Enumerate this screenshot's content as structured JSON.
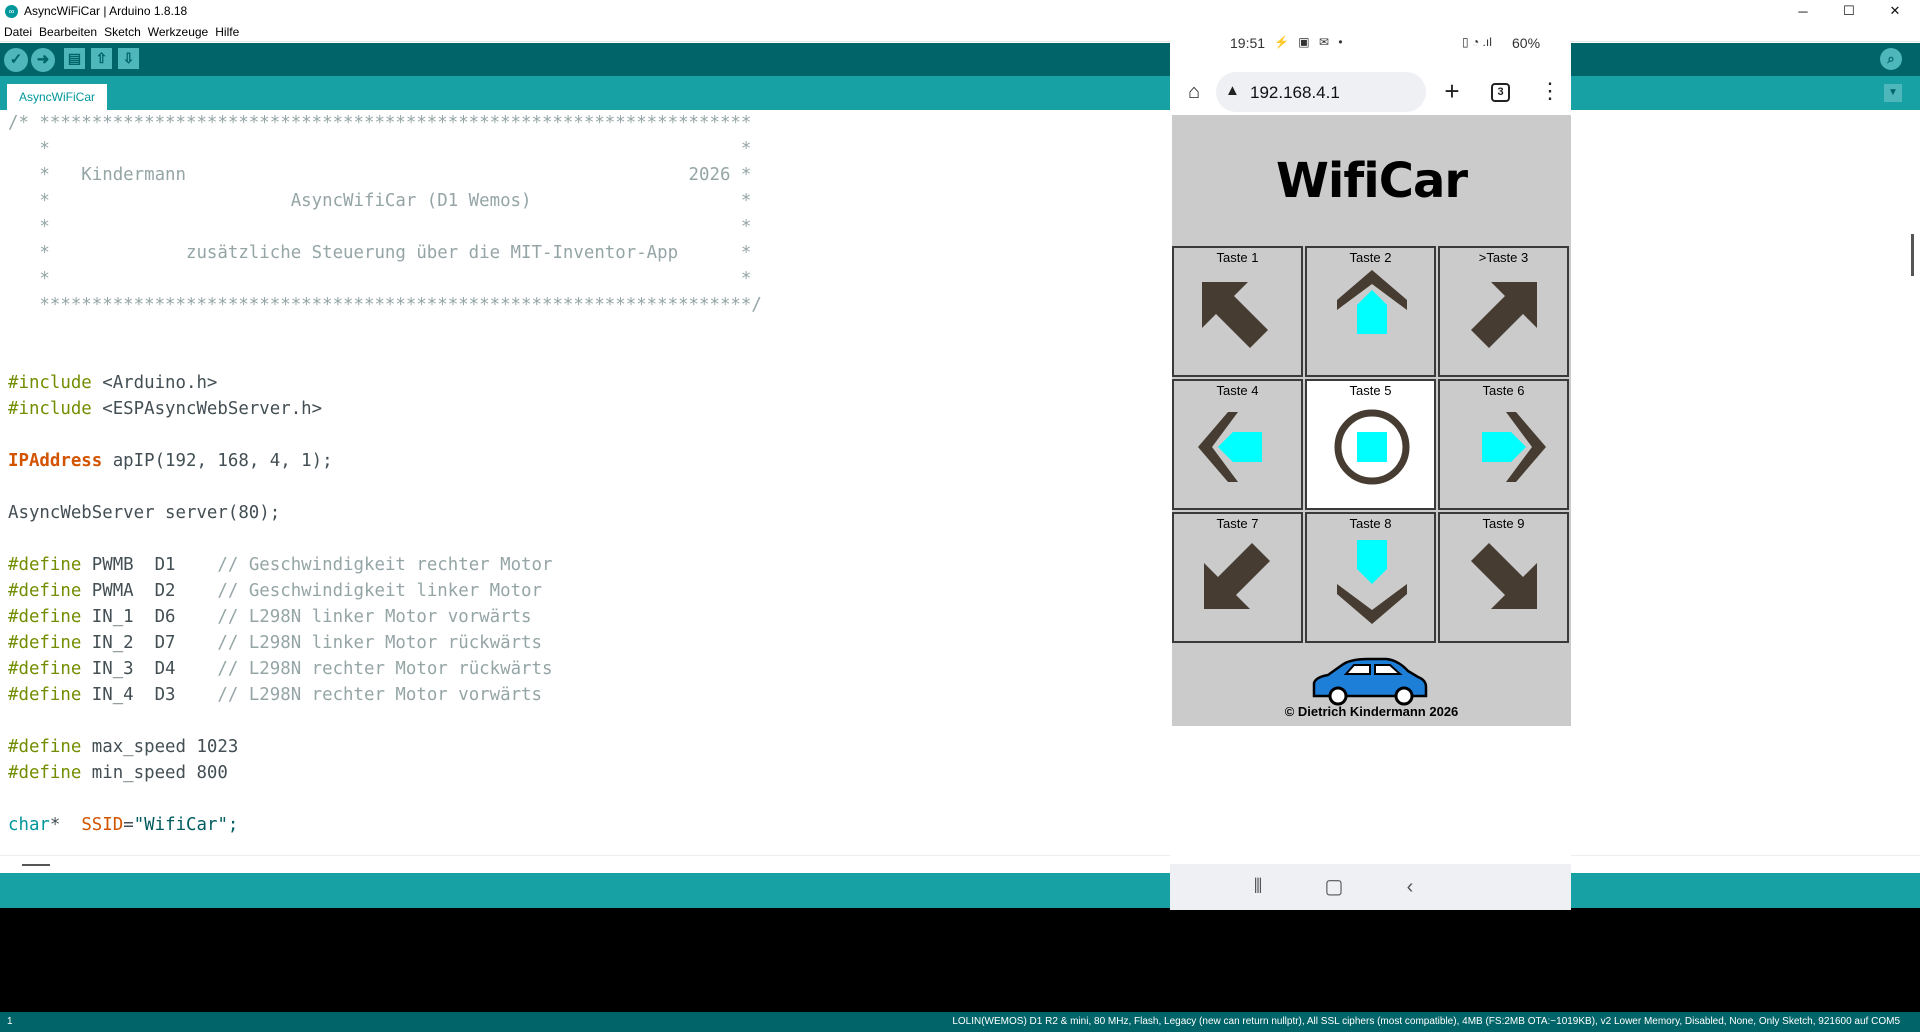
{
  "window": {
    "title": "AsyncWiFiCar | Arduino 1.8.18",
    "minimize": "─",
    "maximize": "☐",
    "close": "✕"
  },
  "menu": {
    "items": [
      "Datei",
      "Bearbeiten",
      "Sketch",
      "Werkzeuge",
      "Hilfe"
    ]
  },
  "toolbar": {
    "verify_icon": "check-icon",
    "upload_icon": "arrow-right-icon",
    "new_icon": "new-file-icon",
    "open_icon": "open-icon",
    "save_icon": "save-icon",
    "serial_monitor_icon": "magnifier-icon"
  },
  "tab": {
    "name": "AsyncWiFiCar"
  },
  "code": {
    "lines": [
      "/* ********************************************************************",
      "   *                                                                  *",
      "   *   Kindermann                                                2026 *",
      "   *                       AsyncWifiCar (D1 Wemos)                    *",
      "   *                                                                  *",
      "   *             zusätzliche Steuerung über die MIT-Inventor-App      *",
      "   *                                                                  *",
      "   ********************************************************************/",
      "",
      "",
      "#include <Arduino.h>",
      "#include <ESPAsyncWebServer.h>",
      "",
      "IPAddress apIP(192, 168, 4, 1);",
      "",
      "AsyncWebServer server(80);",
      "",
      "#define PWMB  D1    // Geschwindigkeit rechter Motor",
      "#define PWMA  D2    // Geschwindigkeit linker Motor",
      "#define IN_1  D6    // L298N linker Motor vorwärts",
      "#define IN_2  D7    // L298N linker Motor rückwärts",
      "#define IN_3  D4    // L298N rechter Motor rückwärts",
      "#define IN_4  D3    // L298N rechter Motor vorwärts",
      "",
      "#define max_speed 1023",
      "#define min_speed 800",
      "",
      "char*  SSID=\"WifiCar\";"
    ]
  },
  "footer": {
    "line_number": "1",
    "board": "LOLIN(WEMOS) D1 R2 & mini, 80 MHz, Flash, Legacy (new can return nullptr), All SSL ciphers (most compatible), 4MB (FS:2MB OTA:~1019KB), v2 Lower Memory, Disabled, None, Only Sketch, 921600 auf COM5"
  },
  "phone": {
    "time": "19:51",
    "status_icons": "⚡ ▣ ✉ •",
    "right_icons": "▯ ◔ .ıl",
    "battery": "60%",
    "url": "192.168.4.1",
    "tab_count": "3",
    "page": {
      "title": "WifiCar",
      "buttons": [
        "Taste 1",
        "Taste 2",
        ">Taste 3",
        "Taste 4",
        "Taste 5",
        "Taste 6",
        "Taste 7",
        "Taste 8",
        "Taste 9"
      ],
      "active_button": 5,
      "copyright": "© Dietrich Kindermann 2026"
    },
    "colors": {
      "arrow": "#473c31",
      "accent": "#00ffff",
      "car": "#1e7fd9",
      "page_bg": "#cbcbcb"
    }
  }
}
